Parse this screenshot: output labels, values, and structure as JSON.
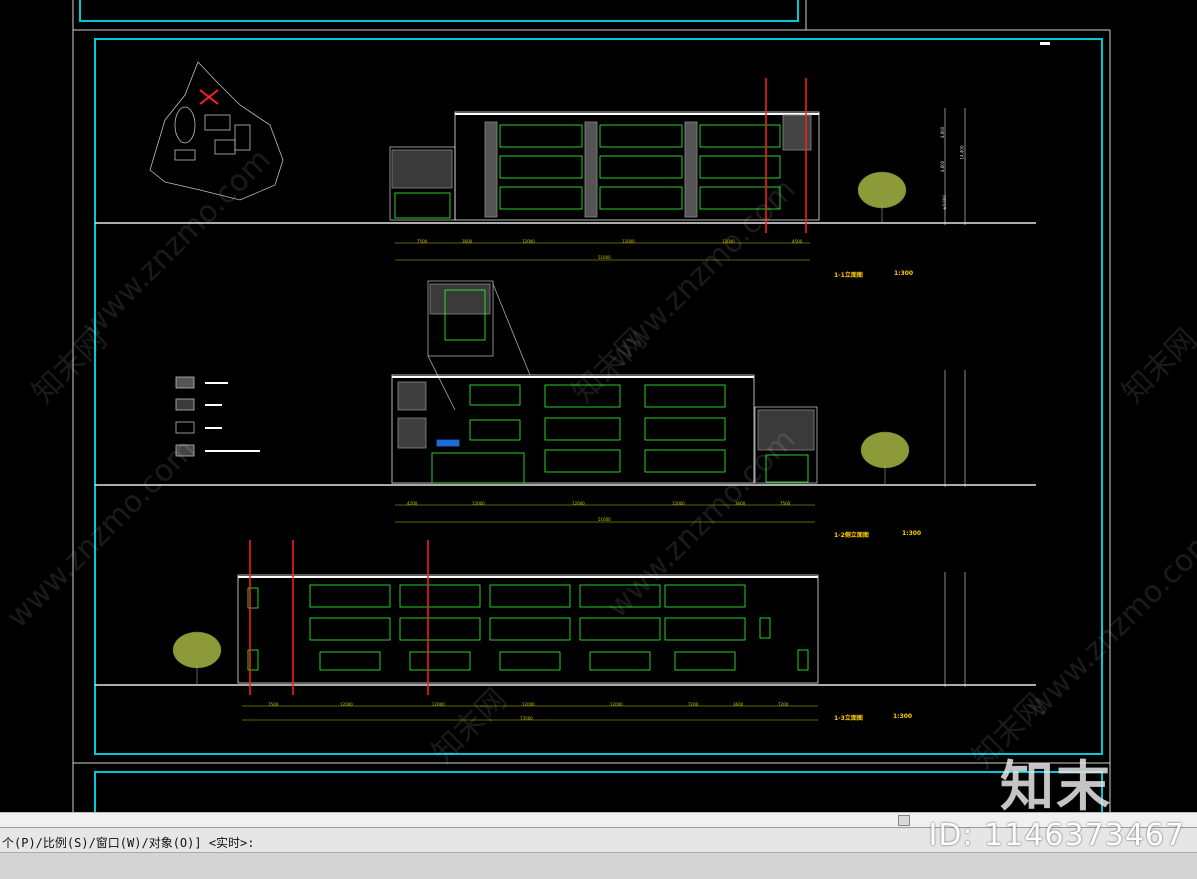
{
  "drawing": {
    "elevations": [
      {
        "title": "1-1立面图",
        "scale": "1:300",
        "dims": [
          "7500",
          "3600",
          "12000",
          "12000",
          "12000",
          "4500"
        ],
        "total": "51600"
      },
      {
        "title": "1-2侧立面图",
        "scale": "1:300",
        "dims": [
          "4200",
          "12000",
          "12000",
          "12000",
          "3600",
          "7500"
        ],
        "total": "51600"
      },
      {
        "title": "1-3立面图",
        "scale": "1:300",
        "dims": [
          "7500",
          "12000",
          "12000",
          "12000",
          "12000",
          "7200",
          "3600",
          "7200"
        ],
        "total": "73500"
      }
    ],
    "level_marks": [
      "4.800",
      "4.800",
      "14.400",
      "±0.000"
    ]
  },
  "watermark": {
    "site_text": "www.znzmo.com",
    "cn_text": "知末网",
    "brand": "知末"
  },
  "command_line": {
    "prompt": "个(P)/比例(S)/窗口(W)/对象(O)] <实时>:"
  },
  "overlay": {
    "id_text": "ID: 1146373467"
  },
  "colors": {
    "frame": "#00c8d8",
    "window": "#33ff33",
    "line": "#e6e6e6",
    "red": "#ff2020",
    "tree": "#8c9a3a",
    "title": "#ffd000"
  }
}
